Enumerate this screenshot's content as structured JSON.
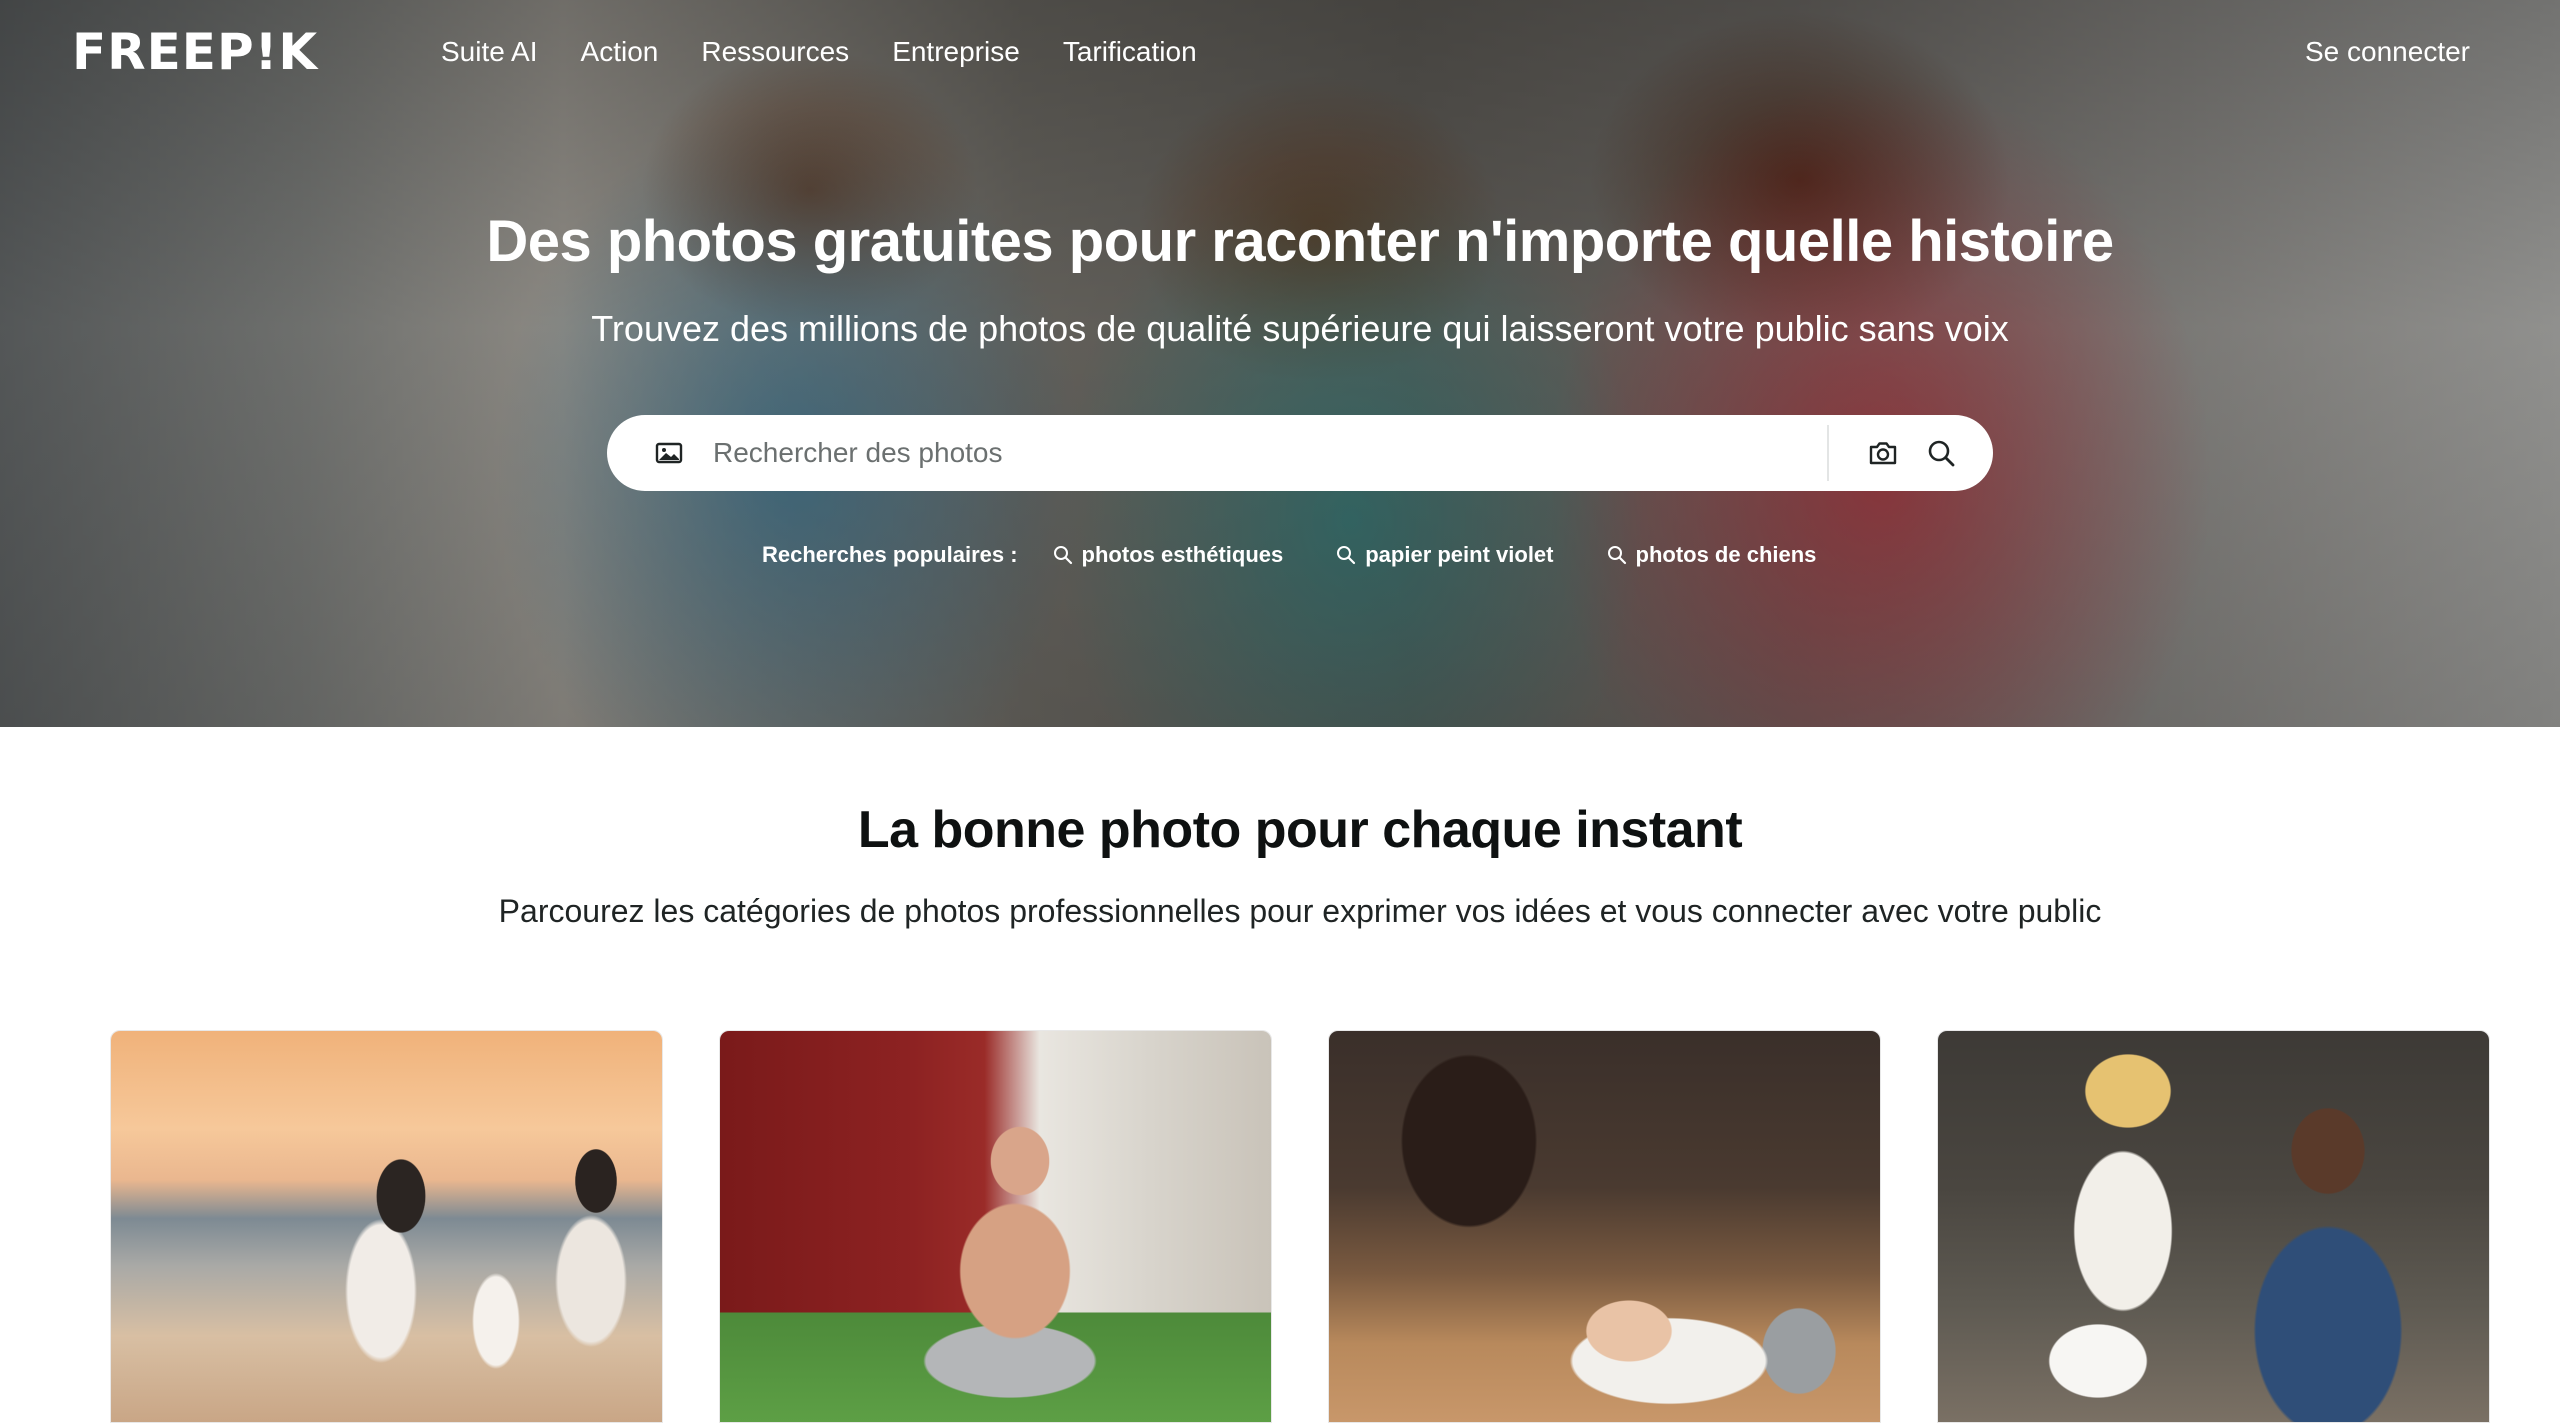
{
  "header": {
    "logo": "FREEP!K",
    "nav": [
      "Suite AI",
      "Action",
      "Ressources",
      "Entreprise",
      "Tarification"
    ],
    "login": "Se connecter"
  },
  "hero": {
    "title": "Des photos gratuites pour raconter n'importe quelle histoire",
    "subtitle": "Trouvez des millions de photos de qualité supérieure qui laisseront votre public sans voix",
    "search": {
      "placeholder": "Rechercher des photos"
    },
    "popular": {
      "label": "Recherches populaires :",
      "tags": [
        "photos esthétiques",
        "papier peint violet",
        "photos de chiens"
      ]
    }
  },
  "section": {
    "title": "La bonne photo pour chaque instant",
    "subtitle": "Parcourez les catégories de photos professionnelles pour exprimer vos idées et vous connecter avec votre public"
  },
  "colors": {
    "text": "#0e1111",
    "white": "#ffffff"
  },
  "icons": {
    "search_mode": "image-icon",
    "visual_search": "camera-icon",
    "submit": "search-icon",
    "tag": "search-icon"
  }
}
